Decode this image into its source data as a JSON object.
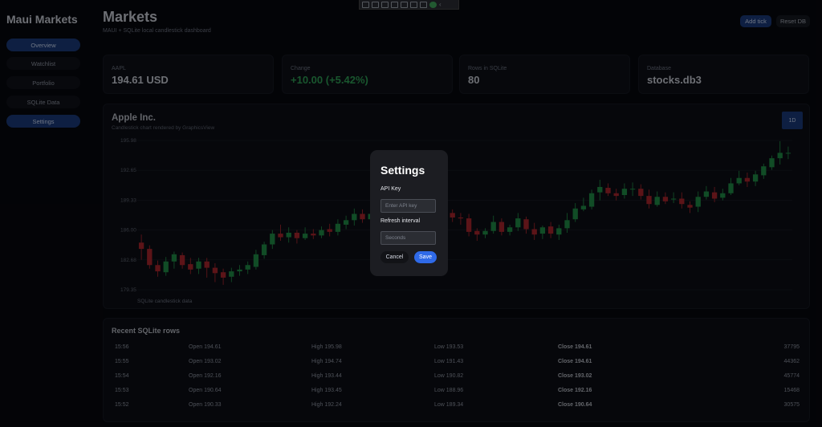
{
  "app": {
    "title": "Maui Markets"
  },
  "nav": [
    "Overview",
    "Watchlist",
    "Portfolio",
    "SQLite Data",
    "Settings"
  ],
  "header": {
    "title": "Markets",
    "subtitle": "MAUI + SQLite local candlestick dashboard",
    "add_tick": "Add tick",
    "reset_db": "Reset DB"
  },
  "cards": [
    {
      "label": "AAPL",
      "value": "194.61 USD"
    },
    {
      "label": "Change",
      "value": "+10.00 (+5.42%)"
    },
    {
      "label": "Rows in SQLite",
      "value": "80"
    },
    {
      "label": "Database",
      "value": "stocks.db3"
    }
  ],
  "chart": {
    "title": "Apple Inc.",
    "subtitle": "Candlestick chart rendered by GraphicsView",
    "range": "1D",
    "footer": "SQLite candlestick data"
  },
  "chart_data": {
    "type": "candlestick",
    "y_ticks": [
      "195.98",
      "192.65",
      "189.33",
      "186.00",
      "182.68",
      "179.35"
    ],
    "ylim": [
      179.35,
      195.98
    ],
    "colors": {
      "up": "#1f8a45",
      "down": "#a8262d"
    },
    "candles": [
      [
        184.6,
        183.9,
        185.5,
        182.7
      ],
      [
        183.9,
        182.1,
        184.3,
        181.7
      ],
      [
        182.1,
        181.4,
        182.6,
        180.8
      ],
      [
        181.3,
        182.5,
        183.0,
        180.9
      ],
      [
        182.5,
        183.3,
        183.6,
        181.7
      ],
      [
        183.2,
        182.1,
        183.5,
        181.7
      ],
      [
        182.2,
        181.6,
        182.9,
        181.1
      ],
      [
        181.7,
        182.5,
        182.9,
        181.1
      ],
      [
        182.5,
        181.8,
        182.9,
        180.7
      ],
      [
        181.8,
        181.2,
        182.3,
        180.2
      ],
      [
        181.3,
        180.7,
        181.7,
        179.9
      ],
      [
        180.8,
        181.4,
        181.8,
        180.2
      ],
      [
        181.4,
        181.6,
        182.1,
        180.9
      ],
      [
        181.6,
        182.1,
        182.5,
        181.1
      ],
      [
        181.9,
        183.3,
        183.8,
        181.6
      ],
      [
        183.2,
        184.4,
        184.7,
        182.8
      ],
      [
        184.4,
        185.6,
        186.0,
        183.9
      ],
      [
        185.6,
        185.2,
        186.6,
        184.8
      ],
      [
        185.2,
        185.7,
        186.3,
        184.6
      ],
      [
        185.7,
        185.1,
        186.0,
        184.5
      ],
      [
        185.1,
        185.6,
        186.3,
        184.9
      ],
      [
        185.6,
        185.4,
        186.1,
        185.0
      ],
      [
        185.4,
        186.0,
        186.4,
        185.1
      ],
      [
        186.1,
        185.8,
        186.7,
        185.3
      ],
      [
        185.8,
        186.7,
        187.2,
        185.4
      ],
      [
        186.6,
        187.1,
        187.6,
        186.1
      ],
      [
        187.1,
        187.8,
        188.4,
        186.5
      ],
      [
        187.8,
        187.2,
        188.3,
        186.8
      ],
      [
        187.2,
        187.8,
        188.1,
        186.9
      ],
      [
        187.8,
        188.3,
        188.6,
        187.3
      ],
      [
        188.4,
        189.6,
        189.9,
        187.9
      ],
      [
        189.6,
        189.7,
        190.1,
        189.2
      ],
      [
        189.6,
        189.2,
        189.9,
        188.8
      ],
      [
        189.3,
        188.9,
        189.6,
        188.6
      ],
      [
        188.9,
        189.4,
        189.9,
        188.5
      ],
      [
        189.5,
        188.7,
        190.1,
        188.2
      ],
      [
        188.8,
        188.4,
        189.6,
        187.8
      ],
      [
        188.5,
        187.8,
        189.2,
        187.4
      ],
      [
        187.9,
        187.4,
        188.3,
        186.9
      ],
      [
        187.4,
        187.3,
        187.9,
        186.6
      ],
      [
        187.3,
        185.8,
        187.8,
        185.3
      ],
      [
        185.9,
        185.5,
        186.2,
        184.8
      ],
      [
        185.5,
        185.9,
        186.2,
        185.1
      ],
      [
        185.9,
        186.9,
        187.6,
        185.6
      ],
      [
        186.9,
        185.8,
        187.3,
        185.4
      ],
      [
        185.8,
        186.3,
        186.6,
        185.4
      ],
      [
        186.3,
        187.3,
        187.9,
        185.9
      ],
      [
        187.2,
        186.1,
        187.5,
        185.6
      ],
      [
        186.1,
        185.5,
        186.8,
        184.9
      ],
      [
        185.6,
        186.3,
        186.5,
        185.0
      ],
      [
        186.4,
        185.6,
        186.9,
        185.1
      ],
      [
        185.5,
        186.2,
        186.6,
        184.9
      ],
      [
        186.2,
        187.1,
        187.9,
        185.7
      ],
      [
        187.2,
        188.4,
        189.0,
        186.9
      ],
      [
        188.3,
        188.7,
        189.6,
        188.1
      ],
      [
        188.6,
        190.1,
        190.5,
        188.3
      ],
      [
        190.2,
        190.8,
        191.6,
        189.3
      ],
      [
        190.7,
        190.1,
        191.2,
        189.8
      ],
      [
        190.1,
        189.8,
        190.6,
        189.3
      ],
      [
        189.9,
        190.6,
        191.2,
        189.5
      ],
      [
        190.6,
        190.6,
        191.3,
        189.8
      ],
      [
        190.6,
        189.8,
        191.1,
        189.4
      ],
      [
        189.8,
        188.9,
        190.5,
        188.4
      ],
      [
        188.8,
        189.7,
        190.3,
        188.6
      ],
      [
        189.7,
        189.2,
        190.2,
        188.9
      ],
      [
        189.4,
        189.5,
        190.2,
        189.0
      ],
      [
        189.5,
        188.9,
        190.2,
        188.4
      ],
      [
        188.8,
        188.5,
        189.2,
        187.9
      ],
      [
        188.6,
        189.7,
        190.3,
        188.0
      ],
      [
        189.7,
        190.3,
        190.9,
        189.4
      ],
      [
        190.2,
        189.5,
        190.8,
        189.1
      ],
      [
        189.6,
        190.1,
        190.6,
        189.3
      ],
      [
        190.1,
        191.2,
        191.8,
        189.9
      ],
      [
        191.2,
        191.8,
        192.6,
        191.0
      ],
      [
        191.8,
        191.4,
        192.4,
        190.8
      ],
      [
        191.4,
        192.2,
        192.6,
        190.9
      ],
      [
        192.1,
        193.1,
        193.4,
        191.7
      ],
      [
        193.0,
        194.0,
        194.3,
        192.7
      ],
      [
        194.0,
        194.6,
        195.9,
        193.3
      ],
      [
        194.6,
        194.6,
        195.3,
        193.9
      ]
    ]
  },
  "recent": {
    "title": "Recent SQLite rows",
    "rows": [
      {
        "time": "15:56",
        "open": "Open 194.61",
        "high": "High 195.98",
        "low": "Low 193.53",
        "close": "Close 194.61",
        "vol": "37795"
      },
      {
        "time": "15:55",
        "open": "Open 193.02",
        "high": "High 194.74",
        "low": "Low 191.43",
        "close": "Close 194.61",
        "vol": "44362"
      },
      {
        "time": "15:54",
        "open": "Open 192.16",
        "high": "High 193.44",
        "low": "Low 190.82",
        "close": "Close 193.02",
        "vol": "45774"
      },
      {
        "time": "15:53",
        "open": "Open 190.64",
        "high": "High 193.45",
        "low": "Low 188.96",
        "close": "Close 192.16",
        "vol": "15468"
      },
      {
        "time": "15:52",
        "open": "Open 190.33",
        "high": "High 192.24",
        "low": "Low 189.34",
        "close": "Close 190.64",
        "vol": "30575"
      }
    ]
  },
  "modal": {
    "title": "Settings",
    "api_label": "API Key",
    "api_placeholder": "Enter API key",
    "refresh_label": "Refresh interval",
    "refresh_placeholder": "Seconds",
    "cancel": "Cancel",
    "save": "Save"
  }
}
